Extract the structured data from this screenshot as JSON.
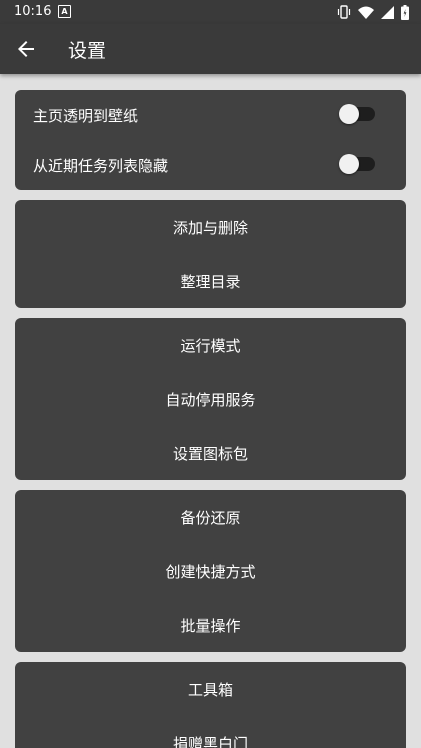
{
  "status_bar": {
    "time": "10:16",
    "notification_badge": "A",
    "icons": [
      "vibrate-icon",
      "wifi-icon",
      "signal-icon",
      "battery-icon"
    ]
  },
  "toolbar": {
    "back_icon": "arrow-back-icon",
    "title": "设置"
  },
  "toggles": [
    {
      "label": "主页透明到壁纸",
      "on": false
    },
    {
      "label": "从近期任务列表隐藏",
      "on": false
    }
  ],
  "groups": [
    {
      "items": [
        "添加与删除",
        "整理目录"
      ]
    },
    {
      "items": [
        "运行模式",
        "自动停用服务",
        "设置图标包"
      ]
    },
    {
      "items": [
        "备份还原",
        "创建快捷方式",
        "批量操作"
      ]
    },
    {
      "items": [
        "工具箱",
        "捐赠黑白门"
      ]
    }
  ],
  "colors": {
    "bar": "#3a3a3a",
    "card": "#414141",
    "page_background": "#e0e0e0"
  }
}
